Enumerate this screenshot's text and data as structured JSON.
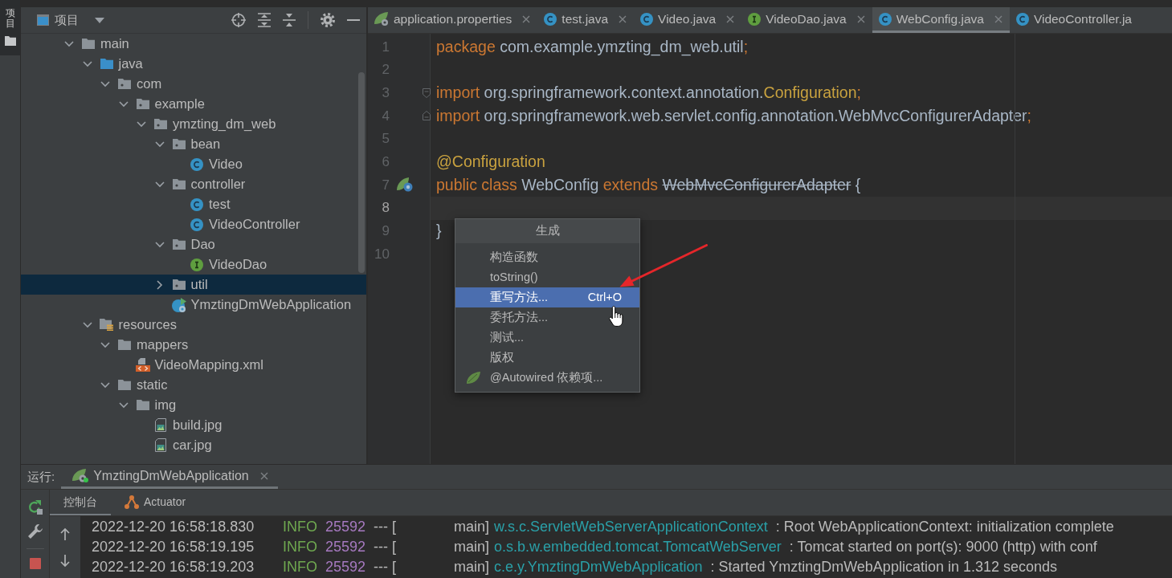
{
  "tool_stripe": [
    {
      "label": "项目",
      "selected": true
    }
  ],
  "project_panel": {
    "title": "项目",
    "tree": [
      {
        "label": "main",
        "kind": "folder",
        "expanded": true,
        "selected": false,
        "children": [
          {
            "label": "java",
            "kind": "source_root",
            "expanded": true,
            "selected": false,
            "children": [
              {
                "label": "com",
                "kind": "package",
                "expanded": true,
                "selected": false,
                "children": [
                  {
                    "label": "example",
                    "kind": "package",
                    "expanded": true,
                    "selected": false,
                    "children": [
                      {
                        "label": "ymzting_dm_web",
                        "kind": "package",
                        "expanded": true,
                        "selected": false,
                        "children": [
                          {
                            "label": "bean",
                            "kind": "package",
                            "expanded": true,
                            "selected": false,
                            "children": [
                              {
                                "label": "Video",
                                "kind": "class",
                                "selected": false
                              }
                            ]
                          },
                          {
                            "label": "controller",
                            "kind": "package",
                            "expanded": true,
                            "selected": false,
                            "children": [
                              {
                                "label": "test",
                                "kind": "class",
                                "selected": false
                              },
                              {
                                "label": "VideoController",
                                "kind": "class",
                                "selected": false
                              }
                            ]
                          },
                          {
                            "label": "Dao",
                            "kind": "package",
                            "expanded": true,
                            "selected": false,
                            "children": [
                              {
                                "label": "VideoDao",
                                "kind": "interface",
                                "selected": false
                              }
                            ]
                          },
                          {
                            "label": "util",
                            "kind": "package",
                            "expanded": false,
                            "selected": true
                          },
                          {
                            "label": "YmztingDmWebApplication",
                            "kind": "app_class",
                            "selected": false
                          }
                        ]
                      }
                    ]
                  }
                ]
              }
            ]
          },
          {
            "label": "resources",
            "kind": "resources_root",
            "expanded": true,
            "selected": false,
            "children": [
              {
                "label": "mappers",
                "kind": "folder",
                "expanded": true,
                "selected": false,
                "children": [
                  {
                    "label": "VideoMapping.xml",
                    "kind": "xml_file",
                    "selected": false
                  }
                ]
              },
              {
                "label": "static",
                "kind": "folder",
                "expanded": true,
                "selected": false,
                "children": [
                  {
                    "label": "img",
                    "kind": "folder",
                    "expanded": true,
                    "selected": false,
                    "children": [
                      {
                        "label": "build.jpg",
                        "kind": "image_file",
                        "selected": false
                      },
                      {
                        "label": "car.jpg",
                        "kind": "image_file",
                        "selected": false
                      }
                    ]
                  }
                ]
              }
            ]
          }
        ]
      }
    ]
  },
  "editor_tabs": [
    {
      "label": "application.properties",
      "kind": "properties",
      "closable": true,
      "selected": false
    },
    {
      "label": "test.java",
      "kind": "class",
      "closable": true,
      "selected": false
    },
    {
      "label": "Video.java",
      "kind": "class",
      "closable": true,
      "selected": false
    },
    {
      "label": "VideoDao.java",
      "kind": "interface",
      "closable": true,
      "selected": false
    },
    {
      "label": "WebConfig.java",
      "kind": "class",
      "closable": true,
      "selected": true
    },
    {
      "label": "VideoController.ja",
      "kind": "class",
      "closable": false,
      "selected": false
    }
  ],
  "code_lines": [
    {
      "number": "1",
      "kind": "plain",
      "tokens": [
        {
          "text": "package",
          "kind": "keyword"
        },
        {
          "text": " com.example.ymzting_dm_web.util",
          "kind": "plain"
        },
        {
          "text": ";",
          "kind": "keyword"
        }
      ],
      "current": false
    },
    {
      "number": "2",
      "kind": "plain",
      "current": false
    },
    {
      "number": "3",
      "kind": "foldstart",
      "tokens": [
        {
          "text": "import",
          "kind": "keyword"
        },
        {
          "text": " org.springframework.context.annotation.",
          "kind": "plain"
        },
        {
          "text": "Configuration",
          "kind": "annotation"
        },
        {
          "text": ";",
          "kind": "keyword"
        }
      ],
      "current": false
    },
    {
      "number": "4",
      "kind": "foldend",
      "tokens": [
        {
          "text": "import",
          "kind": "keyword"
        },
        {
          "text": " org.springframework.web.servlet.config.annotation.WebMvcConfigurerAdapter",
          "kind": "plain"
        },
        {
          "text": ";",
          "kind": "keyword"
        }
      ],
      "current": false
    },
    {
      "number": "5",
      "kind": "plain",
      "current": false
    },
    {
      "number": "6",
      "kind": "plain",
      "tokens": [
        {
          "text": "@Configuration",
          "kind": "annotation"
        }
      ],
      "current": false
    },
    {
      "number": "7",
      "kind": "bean",
      "tokens": [
        {
          "text": "public class",
          "kind": "keyword"
        },
        {
          "text": " WebConfig ",
          "kind": "plain"
        },
        {
          "text": "extends ",
          "kind": "keyword"
        },
        {
          "text": "WebMvcConfigurerAdapter",
          "kind": "deprecated"
        },
        {
          "text": " {",
          "kind": "plain"
        }
      ],
      "current": false
    },
    {
      "number": "8",
      "kind": "plain",
      "current": true
    },
    {
      "number": "9",
      "kind": "plain",
      "tokens": [
        {
          "text": "}",
          "kind": "plain"
        }
      ],
      "current": false
    },
    {
      "number": "10",
      "kind": "plain",
      "current": false
    }
  ],
  "generate_popup": {
    "title": "生成",
    "items": [
      {
        "label": "构造函数",
        "kind": "plain",
        "selected": false
      },
      {
        "label": "toString()",
        "kind": "plain",
        "selected": false
      },
      {
        "label": "重写方法...",
        "kind": "plain",
        "shortcut": "Ctrl+O",
        "selected": true
      },
      {
        "label": "委托方法...",
        "kind": "plain",
        "selected": false
      },
      {
        "label": "测试...",
        "kind": "plain",
        "selected": false
      },
      {
        "label": "版权",
        "kind": "plain",
        "selected": false
      },
      {
        "label": "@Autowired 依赖项...",
        "kind": "spring",
        "selected": false
      }
    ]
  },
  "run_panel": {
    "label": "运行:",
    "tabs": [
      {
        "label": "YmztingDmWebApplication",
        "closable": true,
        "selected": true
      }
    ],
    "subtabs": [
      {
        "label": "控制台",
        "kind": "console",
        "selected": true
      },
      {
        "label": "Actuator",
        "kind": "actuator",
        "selected": false
      }
    ],
    "console_lines": [
      {
        "timestamp": "2022-12-20 16:58:18.830",
        "log_level": "INFO",
        "pid": "25592",
        "separator": "--- [",
        "thread": "main]",
        "logger": "w.s.c.ServletWebServerApplicationContext",
        "message": ": Root WebApplicationContext: initialization complete"
      },
      {
        "timestamp": "2022-12-20 16:58:19.195",
        "log_level": "INFO",
        "pid": "25592",
        "separator": "--- [",
        "thread": "main]",
        "logger": "o.s.b.w.embedded.tomcat.TomcatWebServer",
        "message": ": Tomcat started on port(s): 9000 (http) with conf"
      },
      {
        "timestamp": "2022-12-20 16:58:19.203",
        "log_level": "INFO",
        "pid": "25592",
        "separator": "--- [",
        "thread": "main]",
        "logger": "c.e.y.YmztingDmWebApplication",
        "message": ": Started YmztingDmWebApplication in 1.312 seconds"
      }
    ]
  }
}
